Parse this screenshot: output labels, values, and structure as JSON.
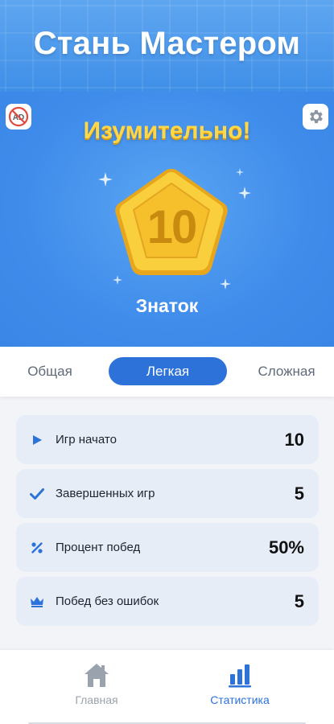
{
  "header": {
    "title": "Стань Мастером"
  },
  "hero": {
    "title": "Изумительно!",
    "level": "10",
    "rank": "Знаток",
    "ad_label": "AD"
  },
  "tabs": [
    {
      "label": "Общая",
      "active": false
    },
    {
      "label": "Легкая",
      "active": true
    },
    {
      "label": "Сложная",
      "active": false
    }
  ],
  "stats": [
    {
      "icon": "play-icon",
      "label": "Игр начато",
      "value": "10"
    },
    {
      "icon": "check-icon",
      "label": "Завершенных игр",
      "value": "5"
    },
    {
      "icon": "percent-icon",
      "label": "Процент побед",
      "value": "50%"
    },
    {
      "icon": "crown-icon",
      "label": "Побед без ошибок",
      "value": "5"
    }
  ],
  "nav": [
    {
      "icon": "home-icon",
      "label": "Главная",
      "active": false
    },
    {
      "icon": "bar-chart-icon",
      "label": "Статистика",
      "active": true
    }
  ],
  "colors": {
    "accent": "#2c72d9",
    "header_bg": "#4a96ec",
    "badge_gold": "#f6c533",
    "title_gold": "#ffd84a",
    "stat_row_bg": "#e6edf7"
  }
}
